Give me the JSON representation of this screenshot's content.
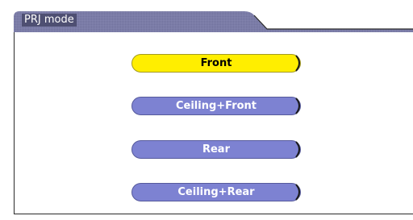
{
  "header": {
    "title": "PRJ mode"
  },
  "options": [
    {
      "label": "Front",
      "selected": true
    },
    {
      "label": "Ceiling+Front",
      "selected": false
    },
    {
      "label": "Rear",
      "selected": false
    },
    {
      "label": "Ceiling+Rear",
      "selected": false
    }
  ],
  "colors": {
    "header_tab": "#7c7da8",
    "header_title_bg": "#4e4f72",
    "selected_button": "#ffee00",
    "normal_button": "#7d82d2",
    "frame_line": "#2a2a2a"
  }
}
